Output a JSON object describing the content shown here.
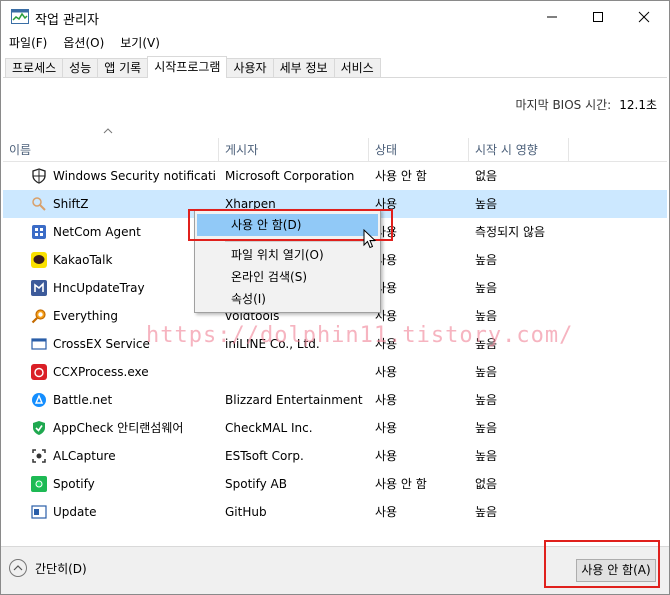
{
  "window": {
    "title": "작업 관리자"
  },
  "menu": [
    "파일(F)",
    "옵션(O)",
    "보기(V)"
  ],
  "tabs": [
    "프로세스",
    "성능",
    "앱 기록",
    "시작프로그램",
    "사용자",
    "세부 정보",
    "서비스"
  ],
  "active_tab_index": 3,
  "bios": {
    "label": "마지막 BIOS 시간:",
    "value": "12.1초"
  },
  "columns": [
    "이름",
    "게시자",
    "상태",
    "시작 시 영향"
  ],
  "rows": [
    {
      "name": "Windows Security notificati...",
      "publisher": "Microsoft Corporation",
      "status": "사용 안 함",
      "impact": "없음",
      "icon": "shield-icon"
    },
    {
      "name": "ShiftZ",
      "publisher": "Xharpen",
      "status": "사용",
      "impact": "높음",
      "icon": "shiftz-icon"
    },
    {
      "name": "NetCom Agent",
      "publisher": "",
      "status": "사용",
      "impact": "측정되지 않음",
      "icon": "netcom-icon"
    },
    {
      "name": "KakaoTalk",
      "publisher": "",
      "status": "사용",
      "impact": "높음",
      "icon": "kakaotalk-icon"
    },
    {
      "name": "HncUpdateTray",
      "publisher": "",
      "status": "사용",
      "impact": "높음",
      "icon": "hnc-icon"
    },
    {
      "name": "Everything",
      "publisher": "voidtools",
      "status": "사용",
      "impact": "높음",
      "icon": "search-icon"
    },
    {
      "name": "CrossEX Service",
      "publisher": "iniLINE Co., Ltd.",
      "status": "사용",
      "impact": "높음",
      "icon": "window-icon"
    },
    {
      "name": "CCXProcess.exe",
      "publisher": "",
      "status": "사용",
      "impact": "높음",
      "icon": "creative-cloud-icon"
    },
    {
      "name": "Battle.net",
      "publisher": "Blizzard Entertainment",
      "status": "사용",
      "impact": "높음",
      "icon": "battlenet-icon"
    },
    {
      "name": "AppCheck 안티랜섬웨어",
      "publisher": "CheckMAL Inc.",
      "status": "사용",
      "impact": "높음",
      "icon": "appcheck-icon"
    },
    {
      "name": "ALCapture",
      "publisher": "ESTsoft Corp.",
      "status": "사용",
      "impact": "높음",
      "icon": "alcapture-icon"
    },
    {
      "name": "Spotify",
      "publisher": "Spotify AB",
      "status": "사용 안 함",
      "impact": "없음",
      "icon": "spotify-icon"
    },
    {
      "name": "Update",
      "publisher": "GitHub",
      "status": "사용",
      "impact": "높음",
      "icon": "update-icon"
    }
  ],
  "selected_row_index": 1,
  "context_menu": [
    "사용 안 함(D)",
    "파일 위치 열기(O)",
    "온라인 검색(S)",
    "속성(I)"
  ],
  "watermark": "https://dolphin11.tistory.com/",
  "footer": {
    "collapse_label": "간단히(D)",
    "disable_button": "사용 안 함(A)"
  },
  "colors": {
    "selection": "#cce8ff",
    "menu_highlight": "#91c9f7",
    "annotation_red": "#e0201c",
    "header_text": "#4c607a"
  }
}
